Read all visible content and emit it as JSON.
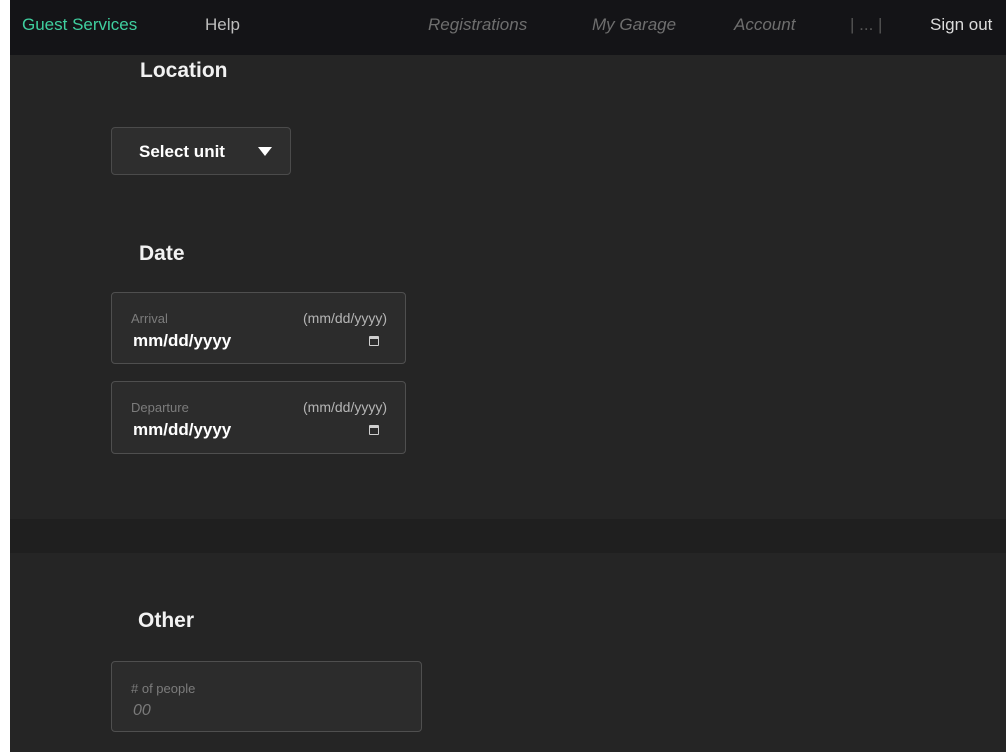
{
  "nav": {
    "brand": "Guest Services",
    "help": "Help",
    "registrations": "Registrations",
    "my_garage": "My Garage",
    "account": "Account",
    "more": "| ... |",
    "sign_out": "Sign out"
  },
  "location": {
    "title": "Location",
    "select_label": "Select unit"
  },
  "date": {
    "title": "Date",
    "arrival": {
      "label": "Arrival",
      "format_hint": "(mm/dd/yyyy)",
      "value": "mm/dd/yyyy"
    },
    "departure": {
      "label": "Departure",
      "format_hint": "(mm/dd/yyyy)",
      "value": "mm/dd/yyyy"
    }
  },
  "other": {
    "title": "Other",
    "people": {
      "label": "# of people",
      "placeholder": "00"
    }
  },
  "colors": {
    "accent": "#3fcf9f",
    "background": "#252525",
    "navbar": "#141417"
  },
  "icons": {
    "dropdown": "caret-down-icon",
    "calendar": "calendar-icon"
  }
}
